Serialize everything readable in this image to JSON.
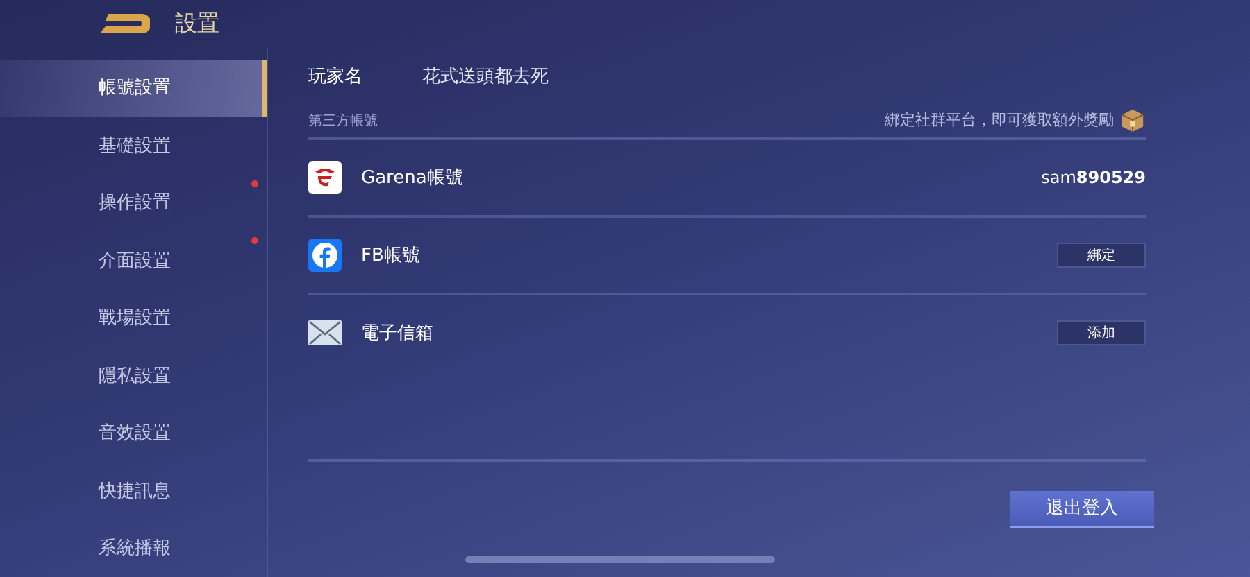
{
  "header": {
    "title": "設置"
  },
  "sidebar": {
    "items": [
      {
        "label": "帳號設置",
        "selected": true,
        "notification": false
      },
      {
        "label": "基礎設置",
        "selected": false,
        "notification": false
      },
      {
        "label": "操作設置",
        "selected": false,
        "notification": true
      },
      {
        "label": "介面設置",
        "selected": false,
        "notification": true
      },
      {
        "label": "戰場設置",
        "selected": false,
        "notification": false
      },
      {
        "label": "隱私設置",
        "selected": false,
        "notification": false
      },
      {
        "label": "音效設置",
        "selected": false,
        "notification": false
      },
      {
        "label": "快捷訊息",
        "selected": false,
        "notification": false
      },
      {
        "label": "系統播報",
        "selected": false,
        "notification": false
      }
    ]
  },
  "player": {
    "label": "玩家名",
    "value": "花式送頭都去死"
  },
  "third_party": {
    "title": "第三方帳號",
    "hint": "綁定社群平台，即可獲取額外獎勵",
    "accounts": [
      {
        "kind": "garena",
        "label": "Garena帳號",
        "value": "sam**890529**"
      },
      {
        "kind": "facebook",
        "label": "FB帳號",
        "button": "綁定"
      },
      {
        "kind": "email",
        "label": "電子信箱",
        "button": "添加"
      }
    ]
  },
  "logout_button": "退出登入"
}
